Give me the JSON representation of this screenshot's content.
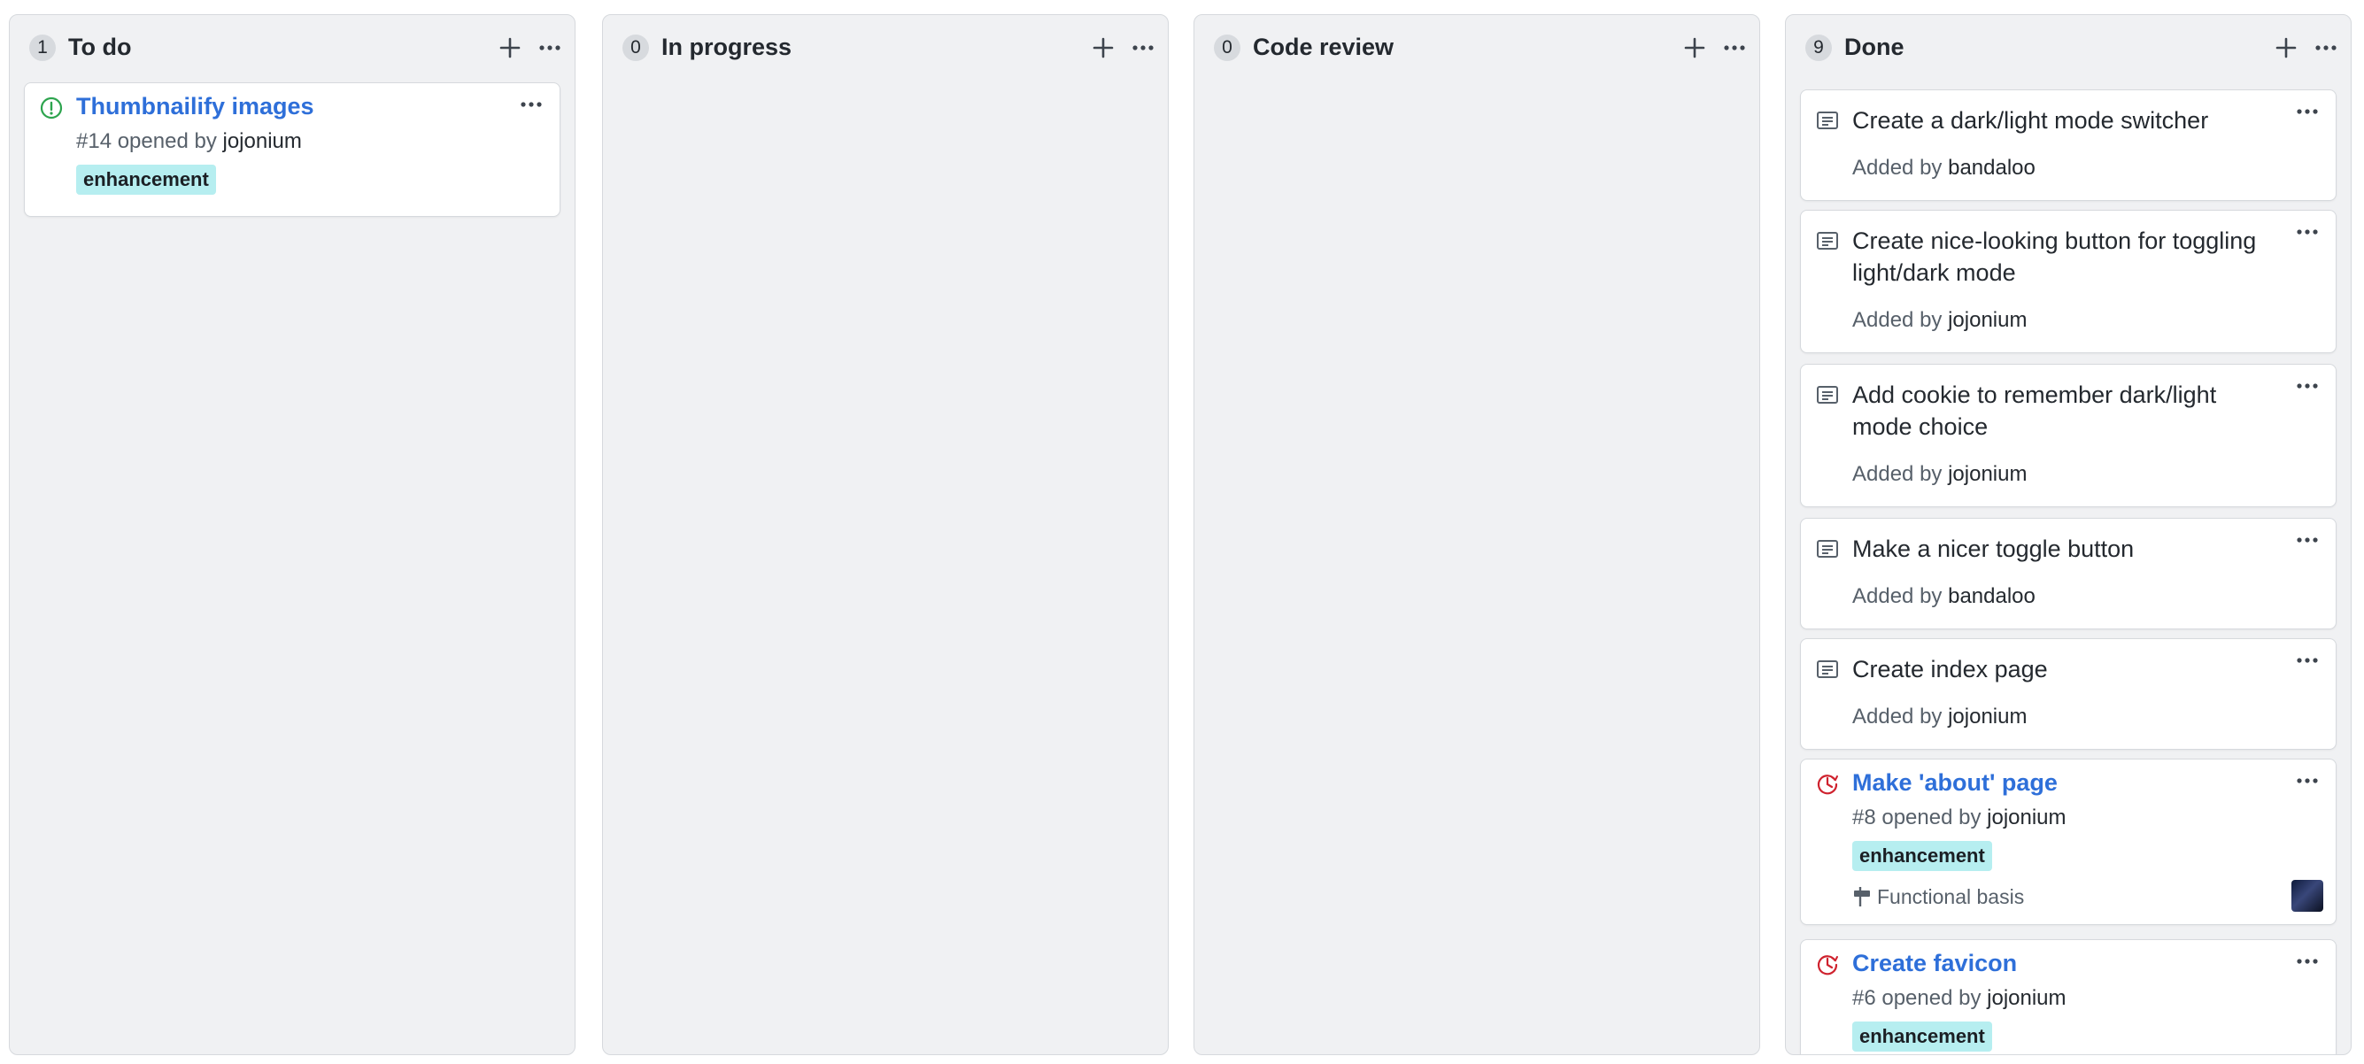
{
  "columns": [
    {
      "count": "1",
      "title": "To do",
      "cards": [
        {
          "kind": "issue-open",
          "title": "Thumbnailify images",
          "meta": "#14 opened by",
          "user": "jojonium",
          "label": "enhancement"
        }
      ]
    },
    {
      "count": "0",
      "title": "In progress",
      "cards": []
    },
    {
      "count": "0",
      "title": "Code review",
      "cards": []
    },
    {
      "count": "9",
      "title": "Done",
      "cards": [
        {
          "kind": "note",
          "title": "Create a dark/light mode switcher",
          "meta": "Added by",
          "user": "bandaloo"
        },
        {
          "kind": "note",
          "title": "Create nice-looking button for toggling light/dark mode",
          "meta": "Added by",
          "user": "jojonium"
        },
        {
          "kind": "note",
          "title": "Add cookie to remember dark/light mode choice",
          "meta": "Added by",
          "user": "jojonium"
        },
        {
          "kind": "note",
          "title": "Make a nicer toggle button",
          "meta": "Added by",
          "user": "bandaloo"
        },
        {
          "kind": "note",
          "title": "Create index page",
          "meta": "Added by",
          "user": "jojonium"
        },
        {
          "kind": "issue-closed",
          "title": "Make 'about' page",
          "meta": "#8 opened by",
          "user": "jojonium",
          "label": "enhancement",
          "milestone": "Functional basis"
        },
        {
          "kind": "issue-closed",
          "title": "Create favicon",
          "meta": "#6 opened by",
          "user": "jojonium",
          "label": "enhancement"
        }
      ]
    }
  ],
  "colors": {
    "issue_open": "#2da44e",
    "issue_closed": "#cf222e",
    "link": "#2e6fd9",
    "label_bg": "#b6eef0",
    "column_bg": "#f0f1f3"
  },
  "icons": {
    "add": "plus-icon",
    "more": "kebab-horizontal-icon",
    "note": "note-icon",
    "issue_open": "issue-opened-icon",
    "issue_closed": "issue-closed-icon",
    "milestone": "milestone-icon"
  }
}
